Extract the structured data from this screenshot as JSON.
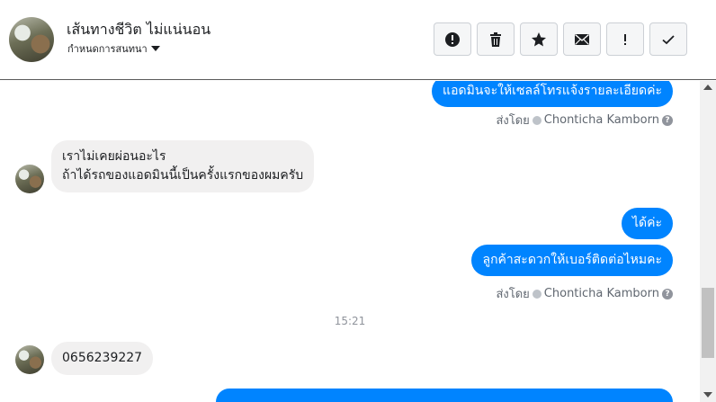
{
  "header": {
    "name": "เส้นทางชีวิต ไม่แน่นอน",
    "subtitle": "กำหนดการสนทนา",
    "actions": [
      {
        "name": "spam-button",
        "icon": "exclamation-circle-icon"
      },
      {
        "name": "delete-button",
        "icon": "trash-icon"
      },
      {
        "name": "star-button",
        "icon": "star-icon"
      },
      {
        "name": "mark-unread-button",
        "icon": "envelope-icon"
      },
      {
        "name": "important-button",
        "icon": "exclamation-icon"
      },
      {
        "name": "done-button",
        "icon": "check-icon"
      }
    ]
  },
  "messages": {
    "out_1": "แอดมินจะให้เซลล์โทรแจ้งรายละเอียดค่ะ",
    "sent_by_1": {
      "prefix": "ส่งโดย",
      "name": "Chonticha Kamborn",
      "help": "?"
    },
    "in_1_line1": "เราไม่เคยผ่อนอะไร",
    "in_1_line2": "ถ้าได้รถของแอดมินนี้เป็นครั้งแรกของผมครับ",
    "out_2": "ได้ค่ะ",
    "out_3": "ลูกค้าสะดวกให้เบอร์ติดต่อไหมคะ",
    "sent_by_2": {
      "prefix": "ส่งโดย",
      "name": "Chonticha Kamborn",
      "help": "?"
    },
    "timestamp": "15:21",
    "in_2": "0656239227"
  },
  "colors": {
    "outgoing_bubble": "#0084ff",
    "incoming_bubble": "#f1f0f0",
    "meta_text": "#606770"
  }
}
